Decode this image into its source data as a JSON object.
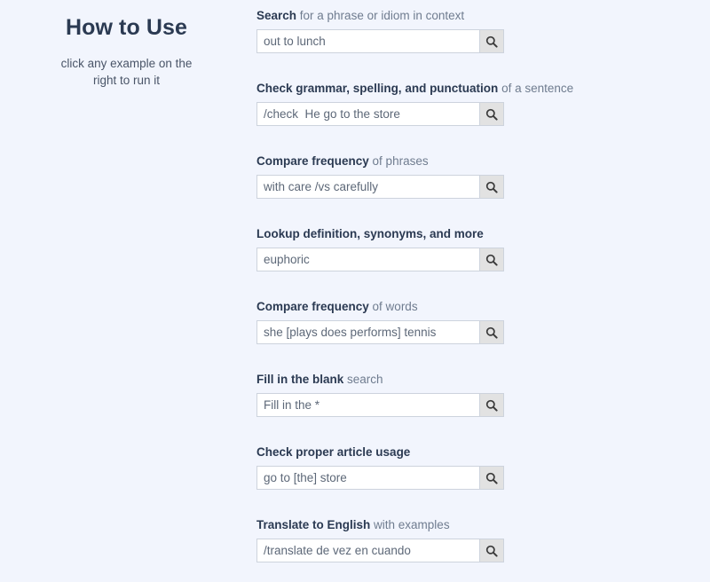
{
  "sidebar": {
    "title": "How to Use",
    "subtitle": "click any example on the right to run it"
  },
  "colors": {
    "page_background": "#f2f5fd",
    "heading": "#2b3a52",
    "label_strong": "#2b3a52",
    "label_light": "#6f7c8f",
    "input_border": "#cdd3dd",
    "input_background": "#ffffff",
    "input_text": "#5d6878",
    "button_background": "#e2e2e2",
    "button_icon": "#3b3b3b"
  },
  "search_icon_name": "search-icon",
  "examples": [
    {
      "label_strong": "Search",
      "label_light": " for a phrase or idiom in context",
      "value": "out to lunch",
      "button_label": "Search"
    },
    {
      "label_strong": "Check grammar, spelling, and punctuation",
      "label_light": " of a sentence",
      "value": "/check  He go to the store",
      "button_label": "Search"
    },
    {
      "label_strong": "Compare frequency",
      "label_light": " of phrases",
      "value": "with care /vs carefully",
      "button_label": "Search"
    },
    {
      "label_strong": "Lookup definition, synonyms, and more",
      "label_light": "",
      "value": "euphoric",
      "button_label": "Search"
    },
    {
      "label_strong": "Compare frequency",
      "label_light": " of words",
      "value": "she [plays does performs] tennis",
      "button_label": "Search"
    },
    {
      "label_strong": "Fill in the blank",
      "label_light": " search",
      "value": "Fill in the *",
      "button_label": "Search"
    },
    {
      "label_strong": "Check proper article usage",
      "label_light": "",
      "value": "go to [the] store",
      "button_label": "Search"
    },
    {
      "label_strong": "Translate to English",
      "label_light": " with examples",
      "value": "/translate de vez en cuando",
      "button_label": "Search"
    }
  ]
}
